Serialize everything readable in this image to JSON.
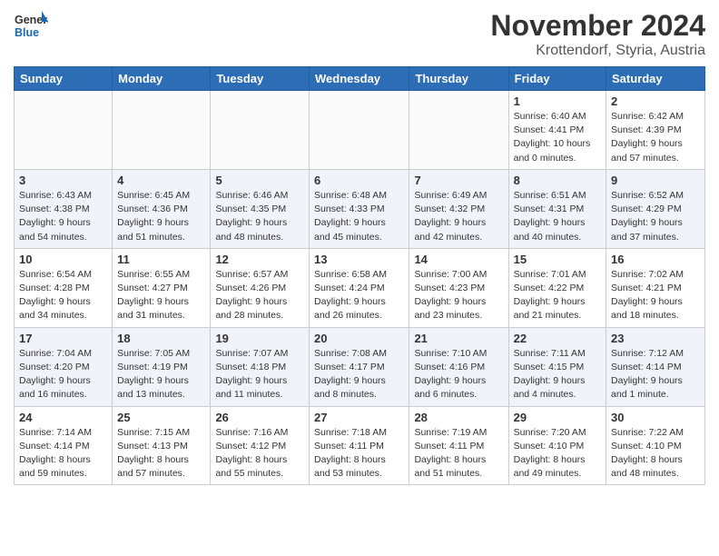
{
  "header": {
    "logo_line1": "General",
    "logo_line2": "Blue",
    "month": "November 2024",
    "location": "Krottendorf, Styria, Austria"
  },
  "weekdays": [
    "Sunday",
    "Monday",
    "Tuesday",
    "Wednesday",
    "Thursday",
    "Friday",
    "Saturday"
  ],
  "weeks": [
    [
      {
        "day": "",
        "info": ""
      },
      {
        "day": "",
        "info": ""
      },
      {
        "day": "",
        "info": ""
      },
      {
        "day": "",
        "info": ""
      },
      {
        "day": "",
        "info": ""
      },
      {
        "day": "1",
        "info": "Sunrise: 6:40 AM\nSunset: 4:41 PM\nDaylight: 10 hours\nand 0 minutes."
      },
      {
        "day": "2",
        "info": "Sunrise: 6:42 AM\nSunset: 4:39 PM\nDaylight: 9 hours\nand 57 minutes."
      }
    ],
    [
      {
        "day": "3",
        "info": "Sunrise: 6:43 AM\nSunset: 4:38 PM\nDaylight: 9 hours\nand 54 minutes."
      },
      {
        "day": "4",
        "info": "Sunrise: 6:45 AM\nSunset: 4:36 PM\nDaylight: 9 hours\nand 51 minutes."
      },
      {
        "day": "5",
        "info": "Sunrise: 6:46 AM\nSunset: 4:35 PM\nDaylight: 9 hours\nand 48 minutes."
      },
      {
        "day": "6",
        "info": "Sunrise: 6:48 AM\nSunset: 4:33 PM\nDaylight: 9 hours\nand 45 minutes."
      },
      {
        "day": "7",
        "info": "Sunrise: 6:49 AM\nSunset: 4:32 PM\nDaylight: 9 hours\nand 42 minutes."
      },
      {
        "day": "8",
        "info": "Sunrise: 6:51 AM\nSunset: 4:31 PM\nDaylight: 9 hours\nand 40 minutes."
      },
      {
        "day": "9",
        "info": "Sunrise: 6:52 AM\nSunset: 4:29 PM\nDaylight: 9 hours\nand 37 minutes."
      }
    ],
    [
      {
        "day": "10",
        "info": "Sunrise: 6:54 AM\nSunset: 4:28 PM\nDaylight: 9 hours\nand 34 minutes."
      },
      {
        "day": "11",
        "info": "Sunrise: 6:55 AM\nSunset: 4:27 PM\nDaylight: 9 hours\nand 31 minutes."
      },
      {
        "day": "12",
        "info": "Sunrise: 6:57 AM\nSunset: 4:26 PM\nDaylight: 9 hours\nand 28 minutes."
      },
      {
        "day": "13",
        "info": "Sunrise: 6:58 AM\nSunset: 4:24 PM\nDaylight: 9 hours\nand 26 minutes."
      },
      {
        "day": "14",
        "info": "Sunrise: 7:00 AM\nSunset: 4:23 PM\nDaylight: 9 hours\nand 23 minutes."
      },
      {
        "day": "15",
        "info": "Sunrise: 7:01 AM\nSunset: 4:22 PM\nDaylight: 9 hours\nand 21 minutes."
      },
      {
        "day": "16",
        "info": "Sunrise: 7:02 AM\nSunset: 4:21 PM\nDaylight: 9 hours\nand 18 minutes."
      }
    ],
    [
      {
        "day": "17",
        "info": "Sunrise: 7:04 AM\nSunset: 4:20 PM\nDaylight: 9 hours\nand 16 minutes."
      },
      {
        "day": "18",
        "info": "Sunrise: 7:05 AM\nSunset: 4:19 PM\nDaylight: 9 hours\nand 13 minutes."
      },
      {
        "day": "19",
        "info": "Sunrise: 7:07 AM\nSunset: 4:18 PM\nDaylight: 9 hours\nand 11 minutes."
      },
      {
        "day": "20",
        "info": "Sunrise: 7:08 AM\nSunset: 4:17 PM\nDaylight: 9 hours\nand 8 minutes."
      },
      {
        "day": "21",
        "info": "Sunrise: 7:10 AM\nSunset: 4:16 PM\nDaylight: 9 hours\nand 6 minutes."
      },
      {
        "day": "22",
        "info": "Sunrise: 7:11 AM\nSunset: 4:15 PM\nDaylight: 9 hours\nand 4 minutes."
      },
      {
        "day": "23",
        "info": "Sunrise: 7:12 AM\nSunset: 4:14 PM\nDaylight: 9 hours\nand 1 minute."
      }
    ],
    [
      {
        "day": "24",
        "info": "Sunrise: 7:14 AM\nSunset: 4:14 PM\nDaylight: 8 hours\nand 59 minutes."
      },
      {
        "day": "25",
        "info": "Sunrise: 7:15 AM\nSunset: 4:13 PM\nDaylight: 8 hours\nand 57 minutes."
      },
      {
        "day": "26",
        "info": "Sunrise: 7:16 AM\nSunset: 4:12 PM\nDaylight: 8 hours\nand 55 minutes."
      },
      {
        "day": "27",
        "info": "Sunrise: 7:18 AM\nSunset: 4:11 PM\nDaylight: 8 hours\nand 53 minutes."
      },
      {
        "day": "28",
        "info": "Sunrise: 7:19 AM\nSunset: 4:11 PM\nDaylight: 8 hours\nand 51 minutes."
      },
      {
        "day": "29",
        "info": "Sunrise: 7:20 AM\nSunset: 4:10 PM\nDaylight: 8 hours\nand 49 minutes."
      },
      {
        "day": "30",
        "info": "Sunrise: 7:22 AM\nSunset: 4:10 PM\nDaylight: 8 hours\nand 48 minutes."
      }
    ]
  ]
}
